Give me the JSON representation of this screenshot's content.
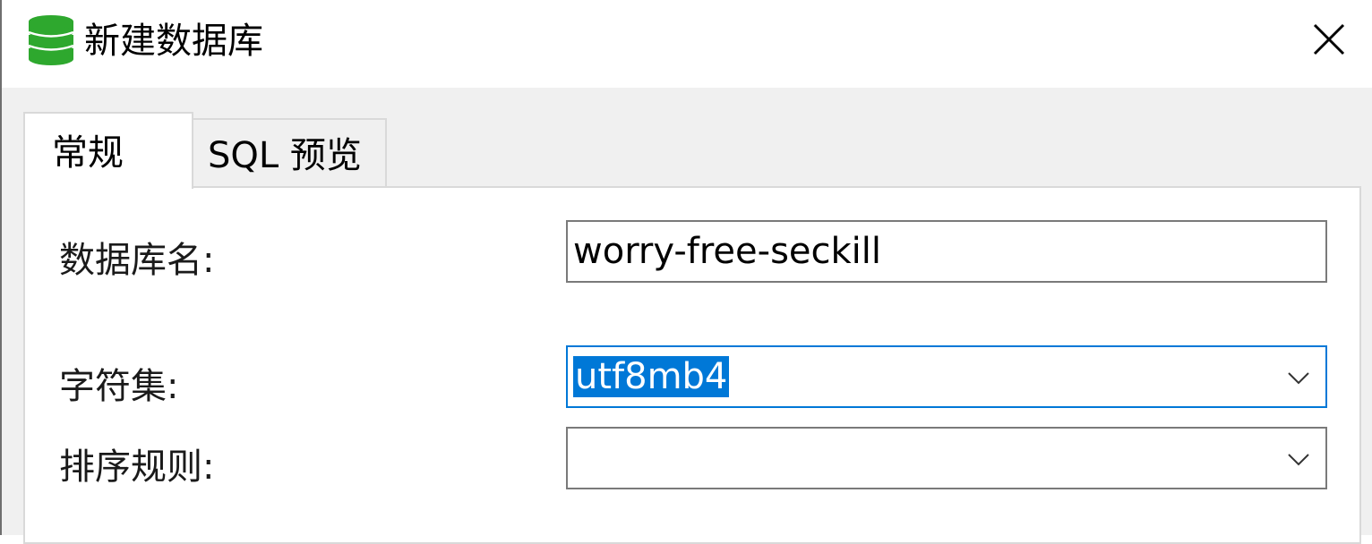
{
  "window": {
    "title": "新建数据库",
    "icon": "database-icon",
    "close_icon": "close-icon"
  },
  "tabs": [
    {
      "label": "常规",
      "active": true
    },
    {
      "label": "SQL 预览",
      "active": false
    }
  ],
  "form": {
    "db_name": {
      "label": "数据库名:",
      "value": "worry-free-seckill"
    },
    "charset": {
      "label": "字符集:",
      "value": "utf8mb4",
      "selected": true,
      "icon": "chevron-down-icon"
    },
    "collation": {
      "label": "排序规则:",
      "value": "",
      "icon": "chevron-down-icon"
    }
  },
  "colors": {
    "accent": "#0078d7",
    "icon_green": "#2ea82e",
    "window_bg": "#f0f0f0"
  }
}
